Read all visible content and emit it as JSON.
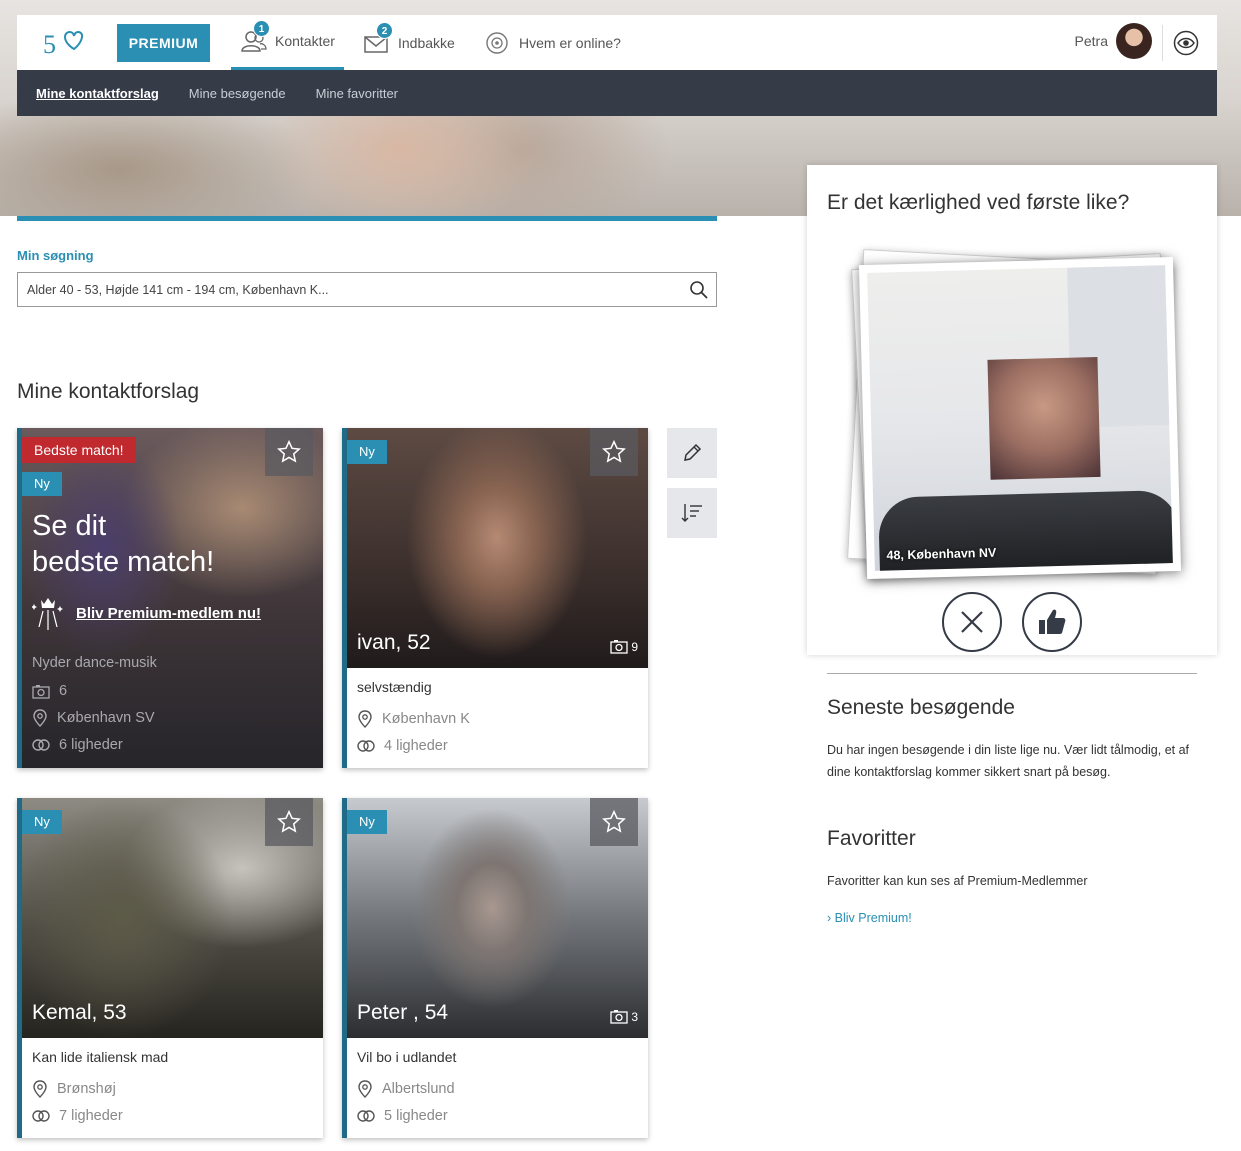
{
  "nav": {
    "premium_label": "PREMIUM",
    "items": [
      {
        "label": "Kontakter",
        "badge": "1"
      },
      {
        "label": "Indbakke",
        "badge": "2"
      },
      {
        "label": "Hvem er online?"
      }
    ],
    "user_name": "Petra"
  },
  "subnav": {
    "items": [
      "Mine kontaktforslag",
      "Mine besøgende",
      "Mine favoritter"
    ]
  },
  "search": {
    "label": "Min søgning",
    "value": "Alder 40 - 53, Højde 141 cm - 194 cm, København K..."
  },
  "section_title": "Mine kontaktforslag",
  "promo": {
    "best_tag": "Bedste match!",
    "new_tag": "Ny",
    "title_line1": "Se dit",
    "title_line2": "bedste match!",
    "link": "Bliv Premium-medlem nu!",
    "interest": "Nyder dance-musik",
    "photos": "6",
    "location": "København SV",
    "likes": "6 ligheder"
  },
  "cards": [
    {
      "tag": "Ny",
      "name": "ivan, 52",
      "photos": "9",
      "desc": "selvstændig",
      "location": "København K",
      "likes": "4 ligheder"
    },
    {
      "tag": "Ny",
      "name": "Kemal, 53",
      "photos": "",
      "desc": "Kan lide italiensk mad",
      "location": "Brønshøj",
      "likes": "7 ligheder"
    },
    {
      "tag": "Ny",
      "name": "Peter , 54",
      "photos": "3",
      "desc": "Vil bo i udlandet",
      "location": "Albertslund",
      "likes": "5 ligheder"
    }
  ],
  "right": {
    "like_title": "Er det kærlighed ved første like?",
    "like_caption": "48, København NV",
    "visitors_title": "Seneste besøgende",
    "visitors_text": "Du har ingen besøgende i din liste lige nu. Vær lidt tålmodig, et af dine kontaktforslag kommer sikkert snart på besøg.",
    "favorites_title": "Favoritter",
    "favorites_text": "Favoritter kan kun ses af Premium-Medlemmer",
    "premium_link": "Bliv Premium!"
  },
  "colors": {
    "accent": "#2a8fb3",
    "subnav_bg": "#353b47",
    "best_match": "#c0292e"
  }
}
